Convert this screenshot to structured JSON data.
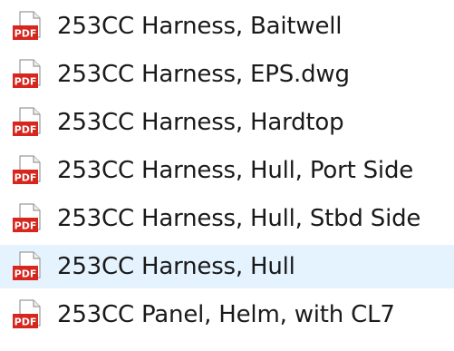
{
  "files": [
    {
      "name": "253CC Harness, Baitwell",
      "icon": "pdf-icon"
    },
    {
      "name": "253CC Harness, EPS.dwg",
      "icon": "pdf-icon"
    },
    {
      "name": "253CC Harness, Hardtop",
      "icon": "pdf-icon"
    },
    {
      "name": "253CC Harness, Hull, Port Side",
      "icon": "pdf-icon"
    },
    {
      "name": "253CC Harness, Hull, Stbd Side",
      "icon": "pdf-icon"
    },
    {
      "name": "253CC Harness, Hull",
      "icon": "pdf-icon",
      "hovered": true
    },
    {
      "name": "253CC Panel, Helm, with CL7",
      "icon": "pdf-icon"
    }
  ],
  "icon_label": "PDF",
  "colors": {
    "pdf_red": "#d7261e",
    "hover_bg": "#e5f3ff",
    "text": "#1a1a1a"
  }
}
